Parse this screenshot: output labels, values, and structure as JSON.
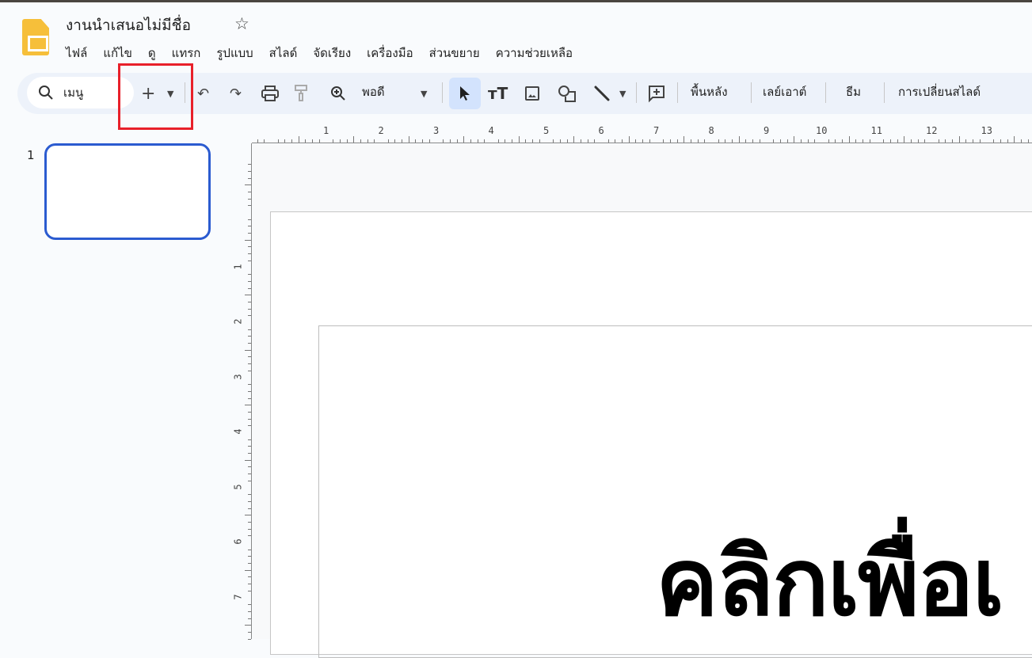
{
  "document": {
    "title": "งานนำเสนอไม่มีชื่อ"
  },
  "menu": [
    "ไฟล์",
    "แก้ไข",
    "ดู",
    "แทรก",
    "รูปแบบ",
    "สไลด์",
    "จัดเรียง",
    "เครื่องมือ",
    "ส่วนขยาย",
    "ความช่วยเหลือ"
  ],
  "toolbar": {
    "search_label": "เมนู",
    "zoom_value": "พอดี",
    "background": "พื้นหลัง",
    "layout": "เลย์เอาต์",
    "theme": "ธีม",
    "transition": "การเปลี่ยนสไลด์"
  },
  "ruler": {
    "horizontal": [
      "1",
      "2",
      "3",
      "4",
      "5",
      "6",
      "7",
      "8",
      "9",
      "10",
      "11",
      "12",
      "13"
    ],
    "vertical": [
      "1",
      "2",
      "3",
      "4",
      "5",
      "6",
      "7"
    ]
  },
  "filmstrip": {
    "slide_number": "1"
  },
  "slide": {
    "title_placeholder": "คลิกเพื่อเ"
  },
  "colors": {
    "accent": "#2b5bd0",
    "highlight": "#e8202a",
    "toolbar_bg": "#edf2fa"
  }
}
